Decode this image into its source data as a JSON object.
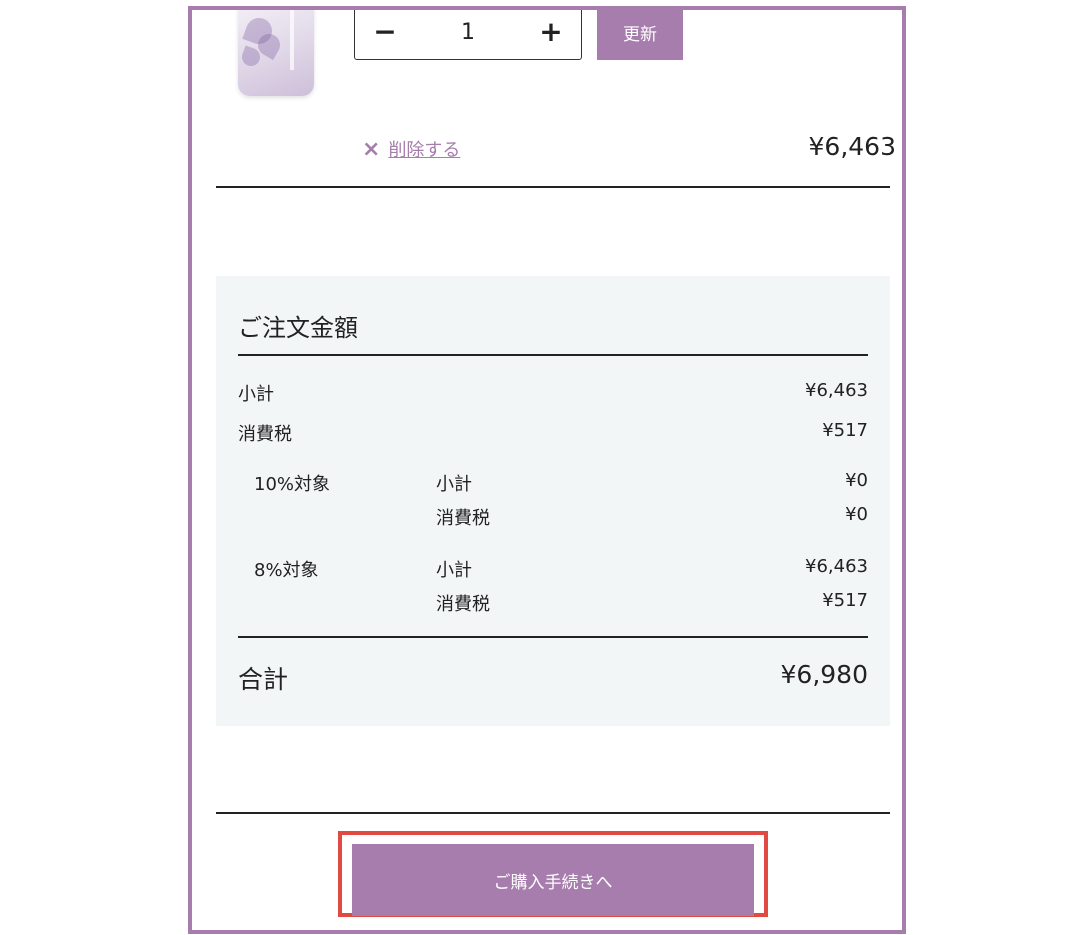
{
  "cart_item": {
    "image_alt": "product-package",
    "quantity": "1",
    "minus_label": "−",
    "plus_label": "+",
    "update_label": "更新",
    "remove_icon": "×",
    "remove_label": "削除する",
    "price": "¥6,463"
  },
  "summary": {
    "title": "ご注文金額",
    "subtotal_label": "小計",
    "subtotal_value": "¥6,463",
    "tax_label": "消費税",
    "tax_value": "¥517",
    "breakdown": [
      {
        "group": "10%対象",
        "subtotal_label": "小計",
        "subtotal_value": "¥0",
        "tax_label": "消費税",
        "tax_value": "¥0"
      },
      {
        "group": "8%対象",
        "subtotal_label": "小計",
        "subtotal_value": "¥6,463",
        "tax_label": "消費税",
        "tax_value": "¥517"
      }
    ],
    "total_label": "合計",
    "total_value": "¥6,980"
  },
  "checkout": {
    "button_label": "ご購入手続きへ"
  },
  "colors": {
    "accent": "#a77dad",
    "highlight_outline": "#e04a43",
    "summary_bg": "#f3f6f7"
  }
}
